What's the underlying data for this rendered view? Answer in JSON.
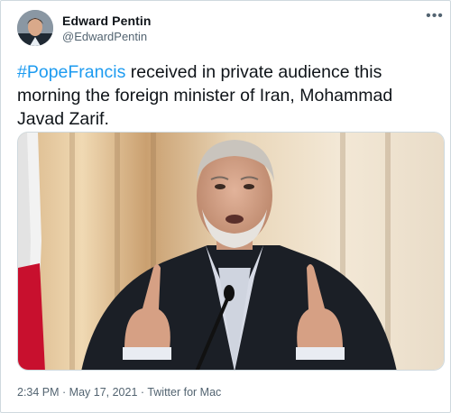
{
  "tweet": {
    "author_name": "Edward Pentin",
    "author_handle": "@EdwardPentin",
    "more_icon": "more-horizontal-icon",
    "text_hashtag": "#PopeFrancis",
    "text_body": " received in private audience this morning the foreign minister of Iran, Mohammad Javad Zarif.",
    "time": "2:34 PM",
    "separator": " · ",
    "date": "May 17, 2021",
    "source": "Twitter for Mac",
    "colors": {
      "hashtag": "#1d9bf0",
      "text": "#0f1419",
      "secondary": "#536471",
      "border": "#cfd9de"
    }
  }
}
